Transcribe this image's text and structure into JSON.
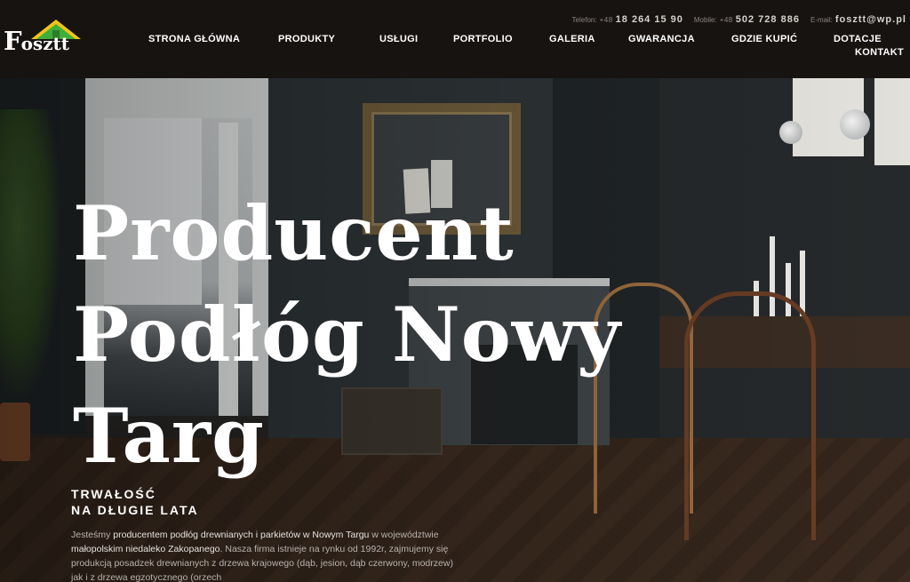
{
  "header": {
    "logo_letter": "F",
    "logo_rest": "osztt",
    "contact": [
      {
        "label": "Telefon:",
        "prefix": "+48",
        "value": "18 264 15 90"
      },
      {
        "label": "Mobile:",
        "prefix": "+48",
        "value": "502 728 886"
      },
      {
        "label": "E-mail:",
        "prefix": "",
        "value": "fosztt@wp.pl"
      }
    ],
    "nav": [
      "STRONA GŁÓWNA",
      "PRODUKTY",
      "USŁUGI",
      "PORTFOLIO",
      "GALERIA",
      "GWARANCJA",
      "GDZIE KUPIĆ",
      "DOTACJE",
      "KONTAKT"
    ]
  },
  "hero": {
    "headline_lines": [
      "Producent",
      "Podłóg Nowy",
      "Targ"
    ],
    "tagline_lines": [
      "TRWAŁOŚĆ",
      "NA DŁUGIE LATA"
    ],
    "description": {
      "part1": "Jesteśmy ",
      "bold1": "producentem podłóg drewnianych i parkietów w Nowym Targu",
      "part2": " w województwie ",
      "bold2": "małopolskim niedaleko Zakopanego",
      "part3": ". Nasza firma istnieje na rynku od 1992r, zajmujemy się produkcją posadzek drewnianych z drzewa krajowego (dąb, jesion, dąb czerwony, modrzew) jak i z drzewa egzotycznego (orzech"
    }
  }
}
